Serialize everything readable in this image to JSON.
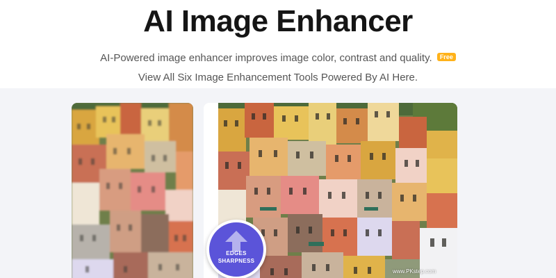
{
  "hero": {
    "title": "AI Image Enhancer",
    "subtitle": "AI-Powered image enhancer improves image color, contrast and quality.",
    "free_badge": "Free",
    "link_text": "View All Six Image Enhancement Tools Powered By AI Here."
  },
  "compare": {
    "badge_line1": "EDGES",
    "badge_line2": "SHARPNESS",
    "badge_icon": "up-arrow-icon",
    "badge_color": "#5b54d9",
    "watermark": "www.PKstep.com"
  },
  "colors": {
    "showcase_background": "#f3f4f8",
    "free_badge": "#ffb21a"
  }
}
